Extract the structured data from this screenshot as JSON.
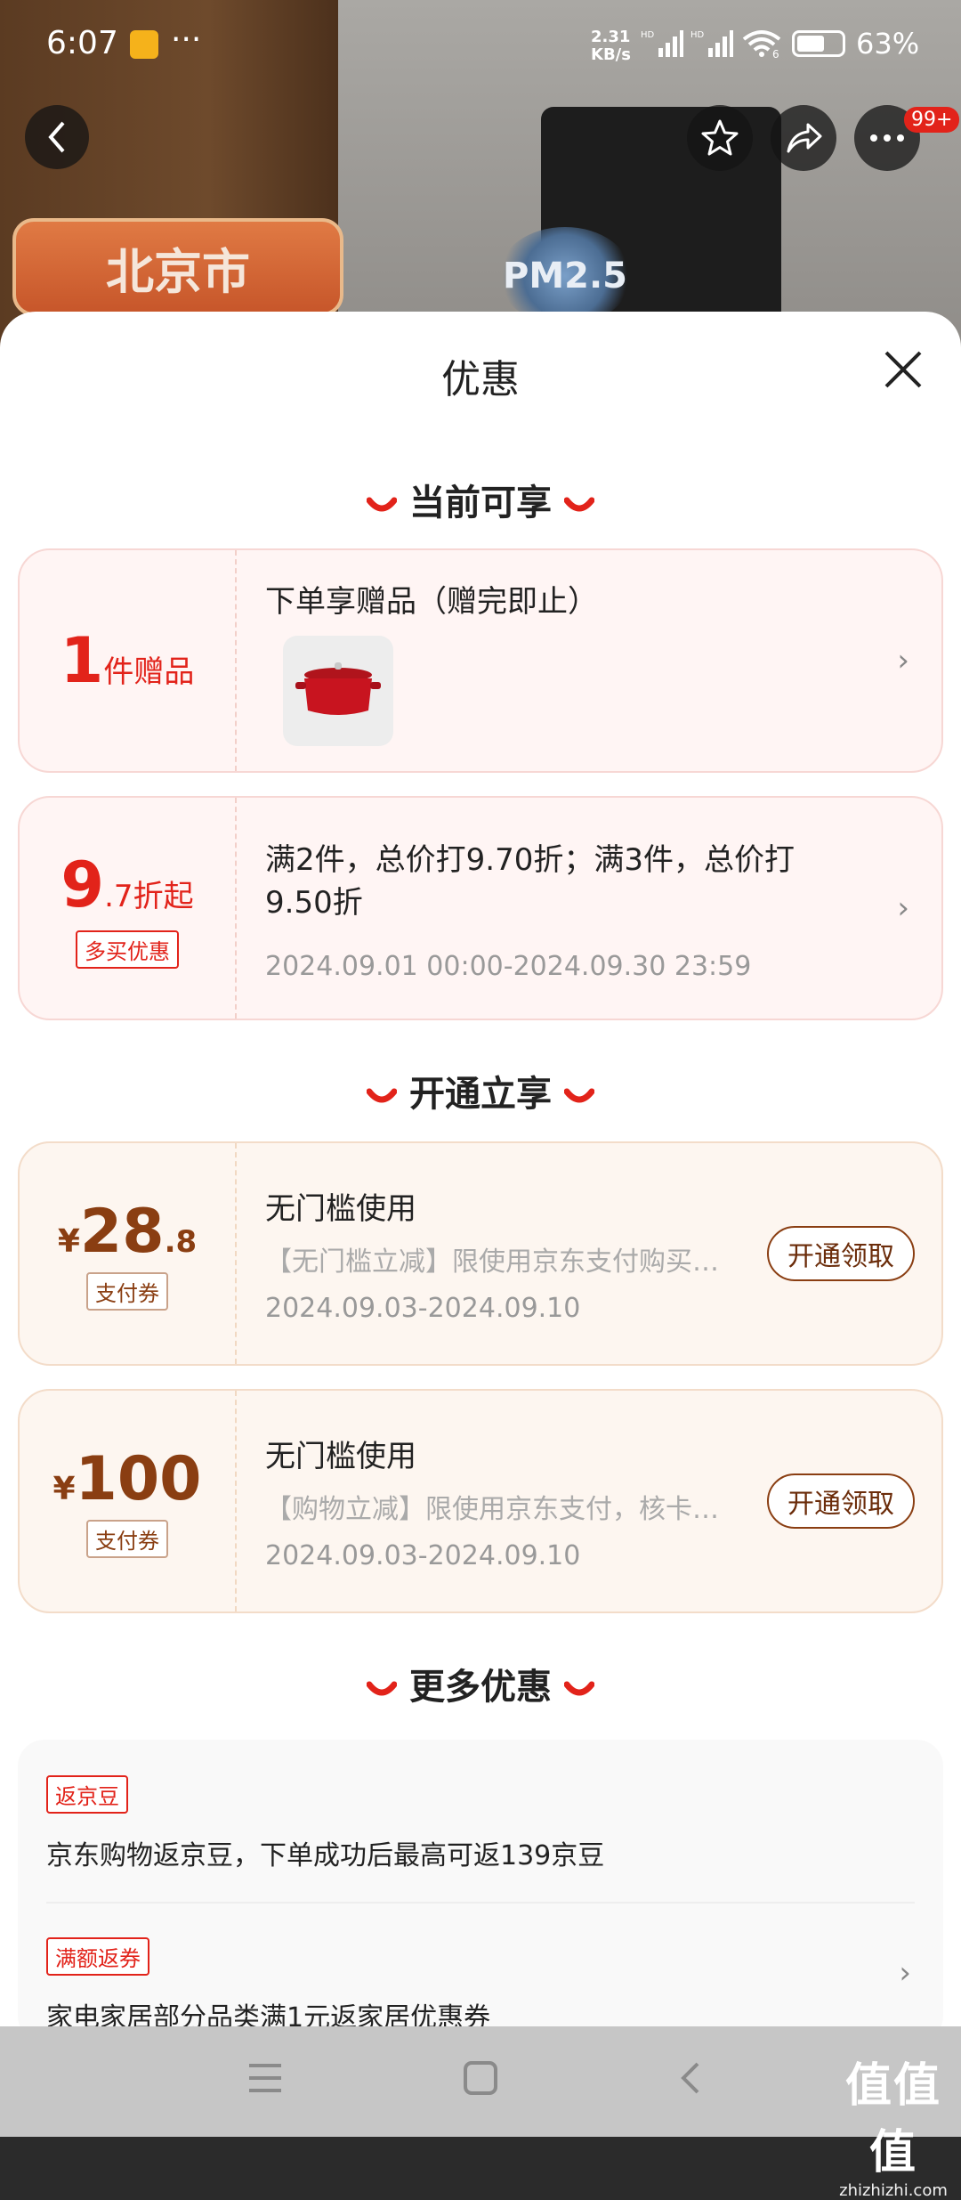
{
  "status_bar": {
    "time": "6:07",
    "more": "···",
    "net_speed_top": "2.31",
    "net_speed_bottom": "KB/s",
    "hd1": "HD",
    "hd2": "HD",
    "wifi_badge": "6",
    "battery": "63%",
    "battery_level": 0.63
  },
  "header": {
    "badge": "99+",
    "city": "北京市",
    "pm_label": "PM2.5"
  },
  "sheet": {
    "title": "优惠"
  },
  "section_current": {
    "title": "当前可享"
  },
  "gift_card": {
    "count": "1",
    "unit": "件赠品",
    "title": "下单享赠品（赠完即止）"
  },
  "discount_card": {
    "big": "9",
    "small": ".7折起",
    "tag": "多买优惠",
    "desc": "满2件，总价打9.70折；满3件，总价打9.50折",
    "period": "2024.09.01 00:00-2024.09.30 23:59"
  },
  "section_open": {
    "title": "开通立享"
  },
  "coupons": [
    {
      "currency": "¥",
      "amount": "28",
      "decimal": ".8",
      "tag": "支付券",
      "title": "无门槛使用",
      "desc": "【无门槛立减】限使用京东支付购买…",
      "period": "2024.09.03-2024.09.10",
      "button": "开通领取"
    },
    {
      "currency": "¥",
      "amount": "100",
      "decimal": "",
      "tag": "支付券",
      "title": "无门槛使用",
      "desc": "【购物立减】限使用京东支付，核卡…",
      "period": "2024.09.03-2024.09.10",
      "button": "开通领取"
    }
  ],
  "section_more": {
    "title": "更多优惠"
  },
  "more_items": [
    {
      "tag": "返京豆",
      "text": "京东购物返京豆，下单成功后最高可返139京豆"
    },
    {
      "tag": "满额返券",
      "text": "家电家居部分品类满1元返家居优惠券"
    }
  ],
  "watermark": {
    "main": "值值值",
    "sub": "zhizhizhi.com"
  }
}
